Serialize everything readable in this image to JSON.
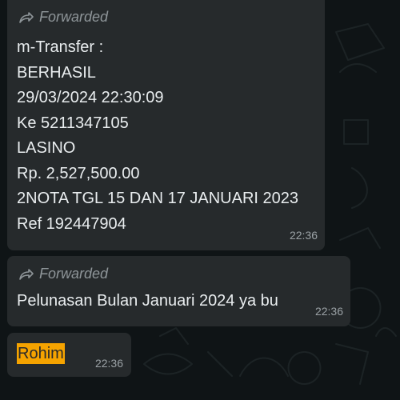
{
  "messages": [
    {
      "forwarded_label": "Forwarded",
      "lines": [
        "m-Transfer :",
        "BERHASIL",
        "29/03/2024 22:30:09",
        "Ke 5211347105",
        "LASINO",
        "Rp. 2,527,500.00",
        "2NOTA TGL 15 DAN 17 JANUARI 2023",
        "Ref 192447904"
      ],
      "time": "22:36"
    },
    {
      "forwarded_label": "Forwarded",
      "text": "Pelunasan Bulan Januari 2024 ya bu",
      "time": "22:36"
    },
    {
      "text": "Rohim",
      "highlight_color": "#f5a300",
      "time": "22:36"
    }
  ],
  "colors": {
    "background": "#0f1416",
    "bubble": "#262a2c",
    "text": "#e9edef",
    "meta": "#8e9599"
  },
  "icons": [
    "forward-arrow-icon"
  ]
}
